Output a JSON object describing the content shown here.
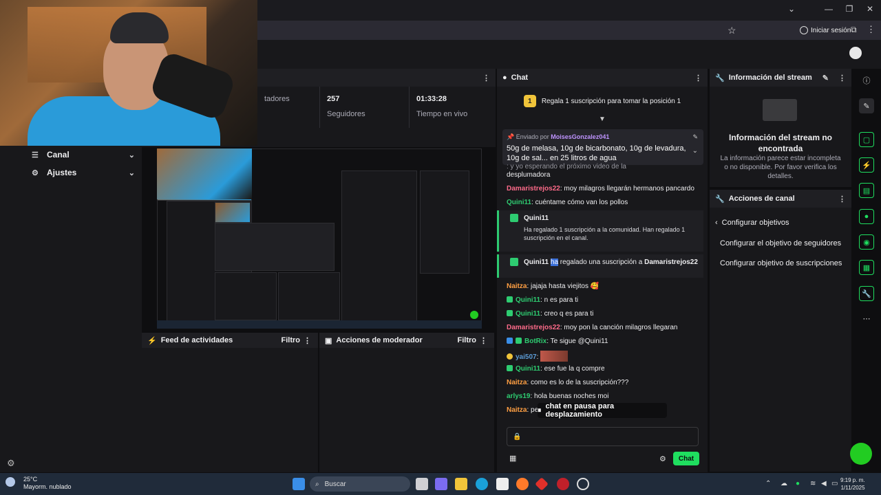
{
  "browser": {
    "signin_label": "Iniciar sesión"
  },
  "nav": {
    "items": [
      {
        "label": "Canal"
      },
      {
        "label": "Ajustes"
      }
    ]
  },
  "stats": [
    {
      "value": "",
      "label": "tadores"
    },
    {
      "value": "257",
      "label": "Seguidores"
    },
    {
      "value": "01:33:28",
      "label": "Tiempo en vivo"
    }
  ],
  "feed": {
    "title": "Feed de actividades",
    "filter": "Filtro"
  },
  "moderator": {
    "title": "Acciones de moderador",
    "filter": "Filtro"
  },
  "chat": {
    "title": "Chat",
    "goal_rank": "1",
    "goal_text": "Regala 1 suscripción para tomar la posición 1",
    "pinned_by_label": "Enviado por",
    "pinned_user": "MoisesGonzalez041",
    "pinned_message": "50g de melasa, 10g de bicarbonato, 10g de levadura, 10g de sal... en 25 litros de agua",
    "partial_text": "desplumadora",
    "partial_prefix": ": y yo esperando el próximo video de la",
    "lines": [
      {
        "user": "Damaristrejos22",
        "text": ": moy milagros llegarán hermanos pancardo",
        "color": "#ff6b8a"
      },
      {
        "user": "Quini11",
        "text": ": cuéntame cómo van los pollos",
        "color": "#2ecc71"
      }
    ],
    "gift1": {
      "user": "Quini11",
      "text": "Ha regalado 1 suscripción a la comunidad. Han regalado 1 suscripción en el canal."
    },
    "gift2": {
      "user": "Quini11",
      "highlight": "ha",
      "text": " regalado una suscripción a ",
      "target": "Damaristrejos22"
    },
    "lines2": [
      {
        "user": "Naitza",
        "text": ": jajaja hasta viejitos 🥰",
        "color": "#ff9f43",
        "badge": false
      },
      {
        "user": "Quini11",
        "text": ": n es para ti",
        "color": "#2ecc71",
        "badge": true
      },
      {
        "user": "Quini11",
        "text": ": creo q es para ti",
        "color": "#2ecc71",
        "badge": true
      },
      {
        "user": "Damaristrejos22",
        "text": ": moy pon la canción milagros llegaran",
        "color": "#ff6b8a",
        "badge": false
      },
      {
        "user": "BotRix",
        "text": ": Te sigue @Quini11",
        "color": "#2ecc71",
        "badge": true
      },
      {
        "user": "yai507",
        "text": ":",
        "color": "#5b9bd5",
        "badge": true
      },
      {
        "user": "Quini11",
        "text": ": ese fue la q compre",
        "color": "#2ecc71",
        "badge": true
      },
      {
        "user": "Naitza",
        "text": ": como es lo de la suscripción???",
        "color": "#ff9f43",
        "badge": false
      },
      {
        "user": "arlys19",
        "text": ": hola buenas noches moi",
        "color": "#2ecc71",
        "badge": false
      },
      {
        "user": "Naitza",
        "text": ": per",
        "color": "#ff9f43",
        "badge": false
      }
    ],
    "pause_label": "chat en pausa para desplazamiento",
    "send_label": "Chat"
  },
  "stream_info": {
    "title": "Información del stream",
    "heading": "Información del stream no encontrada",
    "body": "La información parece estar incompleta o no disponible. Por favor verifica los detalles."
  },
  "channel_actions": {
    "title": "Acciones de canal",
    "back": "Configurar objetivos",
    "items": [
      "Configurar el objetivo de seguidores",
      "Configurar objetivo de suscripciones"
    ]
  },
  "taskbar": {
    "search": "Buscar",
    "weather_temp": "25°C",
    "weather_desc": "Mayorm. nublado",
    "time": "9:19 p. m.",
    "date": "1/11/2025"
  }
}
